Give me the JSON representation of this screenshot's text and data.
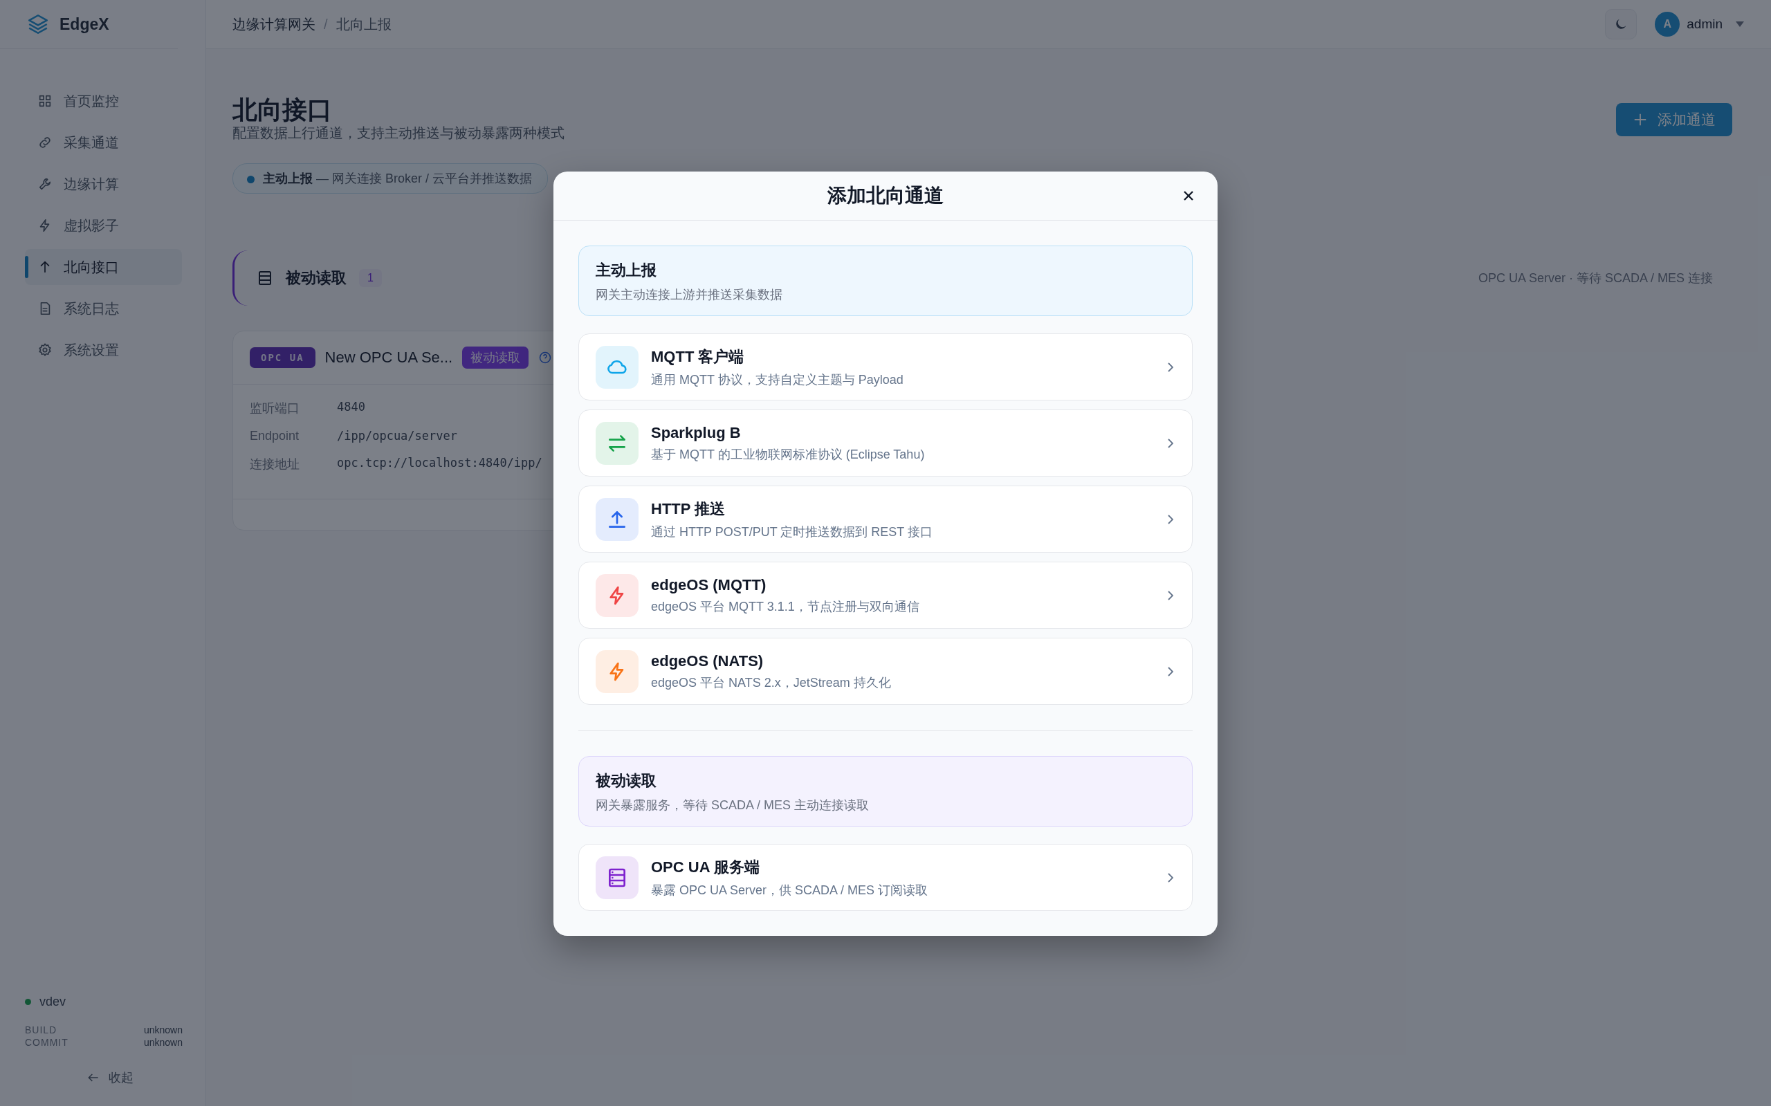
{
  "sidebar": {
    "logo": "EdgeX",
    "items": [
      {
        "label": "首页监控",
        "selected": false
      },
      {
        "label": "采集通道",
        "selected": false
      },
      {
        "label": "边缘计算",
        "selected": false
      },
      {
        "label": "虚拟影子",
        "selected": false
      },
      {
        "label": "北向接口",
        "selected": true
      },
      {
        "label": "系统日志",
        "selected": false
      },
      {
        "label": "系统设置",
        "selected": false
      }
    ],
    "version": "vdev",
    "build": [
      {
        "label": "BUILD",
        "value": "unknown"
      },
      {
        "label": "COMMIT",
        "value": "unknown"
      }
    ],
    "collapse": "收起"
  },
  "header": {
    "breadcrumb": [
      "边缘计算网关",
      "北向上报"
    ],
    "separator": "/",
    "avatar": "A",
    "user": "admin"
  },
  "page": {
    "title": "北向接口",
    "subtitle": "配置数据上行通道，支持主动推送与被动暴露两种模式",
    "add_button": "添加通道",
    "mode_chip": "**主动上报** — 网关连接 Broker / 云平台并推送数据",
    "section": {
      "title": "被动读取",
      "count": "1",
      "note": "OPC UA Server · 等待 SCADA / MES 连接"
    },
    "card": {
      "protocol": "OPC UA",
      "name": "New OPC UA Se...",
      "mode": "被动读取",
      "fields": [
        {
          "label": "监听端口",
          "value": "4840"
        },
        {
          "label": "Endpoint",
          "value": "/ipp/opcua/server"
        },
        {
          "label": "连接地址",
          "value": "opc.tcp://localhost:4840/ipp/"
        }
      ]
    }
  },
  "modal": {
    "title": "添加北向通道",
    "groups": [
      {
        "kind": "push",
        "title": "主动上报",
        "description": "网关主动连接上游并推送采集数据",
        "options": [
          {
            "name": "MQTT 客户端",
            "description": "通用 MQTT 协议，支持自定义主题与 Payload",
            "color": "#0ea5e9"
          },
          {
            "name": "Sparkplug B",
            "description": "基于 MQTT 的工业物联网标准协议 (Eclipse Tahu)",
            "color": "#16a34a"
          },
          {
            "name": "HTTP 推送",
            "description": "通过 HTTP POST/PUT 定时推送数据到 REST 接口",
            "color": "#2563eb"
          },
          {
            "name": "edgeOS (MQTT)",
            "description": "edgeOS 平台 MQTT 3.1.1，节点注册与双向通信",
            "color": "#ef4444"
          },
          {
            "name": "edgeOS (NATS)",
            "description": "edgeOS 平台 NATS 2.x，JetStream 持久化",
            "color": "#f97316"
          }
        ]
      },
      {
        "kind": "pull",
        "title": "被动读取",
        "description": "网关暴露服务，等待 SCADA / MES 主动连接读取",
        "options": [
          {
            "name": "OPC UA 服务端",
            "description": "暴露 OPC UA Server，供 SCADA / MES 订阅读取",
            "color": "#7e22ce"
          }
        ]
      }
    ]
  }
}
